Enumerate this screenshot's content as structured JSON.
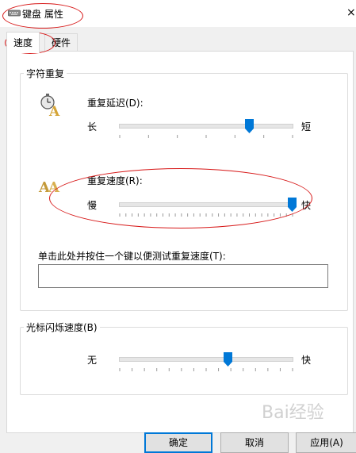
{
  "window": {
    "title": "键盘 属性",
    "close_glyph": "×"
  },
  "tabs": [
    {
      "label": "速度",
      "active": true
    },
    {
      "label": "硬件",
      "active": false
    }
  ],
  "char_repeat": {
    "legend": "字符重复",
    "delay": {
      "label": "重复延迟(D):",
      "left": "长",
      "right": "短",
      "value_fraction": 0.75
    },
    "rate": {
      "label": "重复速度(R):",
      "left": "慢",
      "right": "快",
      "value_fraction": 1.0
    },
    "test": {
      "label": "单击此处并按住一个键以便测试重复速度(T):",
      "value": ""
    }
  },
  "cursor_blink": {
    "legend": "光标闪烁速度(B)",
    "left": "无",
    "right": "快",
    "value_fraction": 0.63
  },
  "buttons": {
    "ok": "确定",
    "cancel": "取消",
    "apply": "应用(A)"
  },
  "watermark": "Bai经验",
  "colors": {
    "accent": "#0078d7",
    "annotation": "#d71818"
  }
}
